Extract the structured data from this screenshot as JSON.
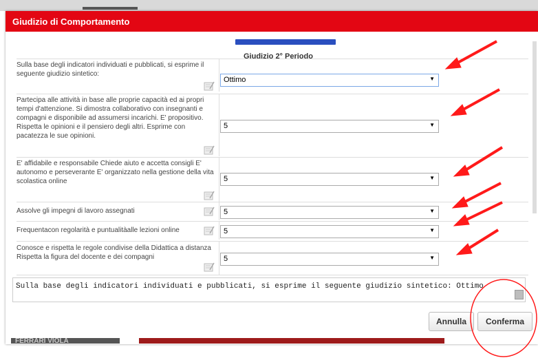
{
  "dialog": {
    "title": "Giudizio di Comportamento",
    "period_heading": "Giudizio  2° Periodo"
  },
  "rows": [
    {
      "label": "Sulla base degli indicatori individuati e pubblicati, si esprime il seguente giudizio sintetico:",
      "value": "Ottimo"
    },
    {
      "label": "Partecipa alle attività in base alle proprie capacità ed ai propri tempi d'attenzione. Si dimostra collaborativo con insegnanti e compagni e disponibile ad assumersi incarichi. E' propositivo. Rispetta le opinioni e il pensiero degli altri. Esprime con pacatezza le sue opinioni.",
      "value": "5"
    },
    {
      "label": "E' affidabile e responsabile Chiede aiuto e accetta consigli E' autonomo e perseverante E' organizzato nella gestione della vita scolastica online",
      "value": "5"
    },
    {
      "label": "Assolve gli impegni di lavoro assegnati",
      "value": "5"
    },
    {
      "label": "Frequentacon regolarità e puntualitàalle lezioni online",
      "value": "5"
    },
    {
      "label": "Conosce e rispetta le regole condivise della Didattica a distanza Rispetta la figura del docente e dei compagni",
      "value": "5"
    }
  ],
  "summary_text": "Sulla base degli indicatori individuati e pubblicati, si esprime il seguente giudizio sintetico: Ottimo",
  "buttons": {
    "cancel": "Annulla",
    "confirm": "Conferma"
  },
  "background_name": "FERRARI VIOLA",
  "colors": {
    "title_bar": "#e30613",
    "annotation": "#ff0000"
  },
  "icons": {
    "note": "edit-note-icon",
    "dropdown": "dropdown-arrow-icon"
  }
}
